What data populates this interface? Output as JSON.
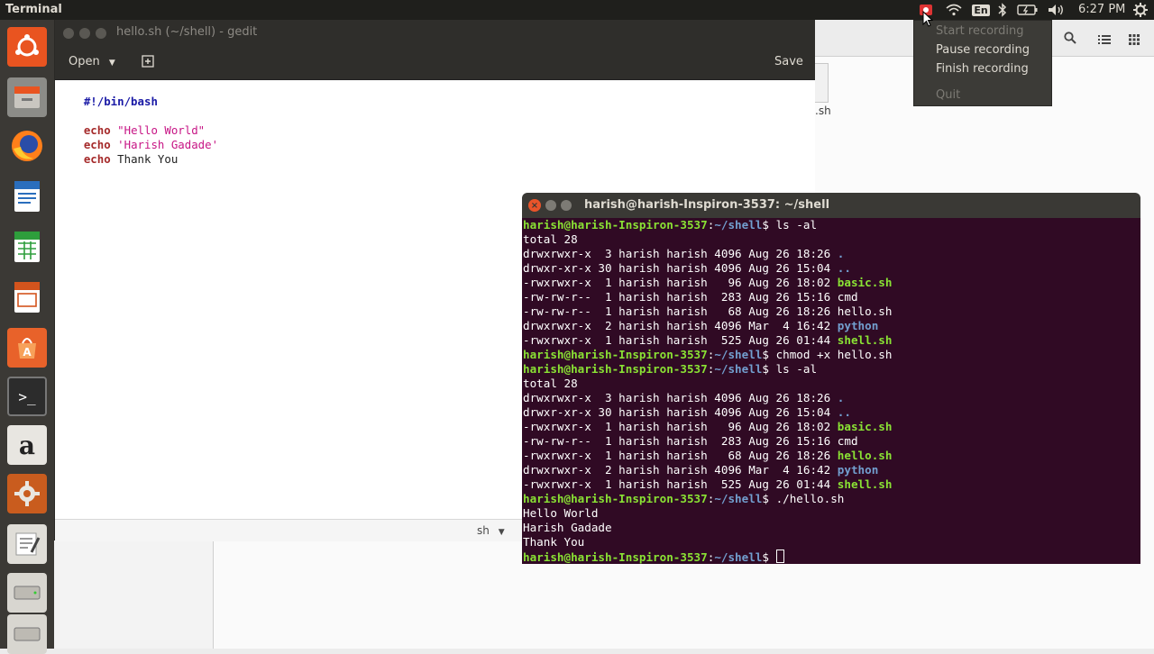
{
  "topbar": {
    "app_name": "Terminal",
    "clock": "6:27 PM",
    "keyboard_layout": "En",
    "icons": [
      "recording-indicator-icon",
      "wifi-icon",
      "keyboard-layout-icon",
      "bluetooth-icon",
      "battery-icon",
      "volume-icon",
      "power-gear-icon"
    ]
  },
  "indicator_menu": {
    "start": "Start recording",
    "pause": "Pause recording",
    "finish": "Finish recording",
    "quit": "Quit"
  },
  "launcher": {
    "items": [
      "ubuntu-dash-icon",
      "files-icon",
      "firefox-icon",
      "libreoffice-writer-icon",
      "libreoffice-calc-icon",
      "libreoffice-impress-icon",
      "software-center-icon",
      "terminal-icon",
      "amazon-icon",
      "system-settings-icon",
      "text-editor-icon",
      "drive-icon",
      "drive-icon-2"
    ]
  },
  "file_manager": {
    "partial_file_label": ".sh"
  },
  "gedit": {
    "title": "hello.sh (~/shell) - gedit",
    "open_label": "Open",
    "save_label": "Save",
    "language": "sh",
    "lines": [
      {
        "kw": "#!/bin/bash",
        "rest": ""
      },
      {
        "kw": "",
        "rest": ""
      },
      {
        "kw": "echo",
        "rest": "\"Hello World\""
      },
      {
        "kw": "echo",
        "rest": "'Harish Gadade'"
      },
      {
        "kw": "echo",
        "rest": "Thank You"
      }
    ]
  },
  "terminal": {
    "title": "harish@harish-Inspiron-3537: ~/shell",
    "prompt_user": "harish@harish-Inspiron-3537",
    "prompt_path": "~/shell",
    "lines": [
      {
        "type": "cmd",
        "cmd": "ls -al"
      },
      {
        "type": "out",
        "text": "total 28"
      },
      {
        "type": "ls",
        "meta": "drwxrwxr-x  3 harish harish 4096 Aug 26 18:26",
        "name": ".",
        "cls": "dir"
      },
      {
        "type": "ls",
        "meta": "drwxr-xr-x 30 harish harish 4096 Aug 26 15:04",
        "name": "..",
        "cls": "dir"
      },
      {
        "type": "ls",
        "meta": "-rwxrwxr-x  1 harish harish   96 Aug 26 18:02",
        "name": "basic.sh",
        "cls": "exe"
      },
      {
        "type": "ls",
        "meta": "-rw-rw-r--  1 harish harish  283 Aug 26 15:16",
        "name": "cmd",
        "cls": ""
      },
      {
        "type": "ls",
        "meta": "-rw-rw-r--  1 harish harish   68 Aug 26 18:26",
        "name": "hello.sh",
        "cls": ""
      },
      {
        "type": "ls",
        "meta": "drwxrwxr-x  2 harish harish 4096 Mar  4 16:42",
        "name": "python",
        "cls": "dir"
      },
      {
        "type": "ls",
        "meta": "-rwxrwxr-x  1 harish harish  525 Aug 26 01:44",
        "name": "shell.sh",
        "cls": "exe"
      },
      {
        "type": "cmd",
        "cmd": "chmod +x hello.sh"
      },
      {
        "type": "cmd",
        "cmd": "ls -al"
      },
      {
        "type": "out",
        "text": "total 28"
      },
      {
        "type": "ls",
        "meta": "drwxrwxr-x  3 harish harish 4096 Aug 26 18:26",
        "name": ".",
        "cls": "dir"
      },
      {
        "type": "ls",
        "meta": "drwxr-xr-x 30 harish harish 4096 Aug 26 15:04",
        "name": "..",
        "cls": "dir"
      },
      {
        "type": "ls",
        "meta": "-rwxrwxr-x  1 harish harish   96 Aug 26 18:02",
        "name": "basic.sh",
        "cls": "exe"
      },
      {
        "type": "ls",
        "meta": "-rw-rw-r--  1 harish harish  283 Aug 26 15:16",
        "name": "cmd",
        "cls": ""
      },
      {
        "type": "ls",
        "meta": "-rwxrwxr-x  1 harish harish   68 Aug 26 18:26",
        "name": "hello.sh",
        "cls": "exe"
      },
      {
        "type": "ls",
        "meta": "drwxrwxr-x  2 harish harish 4096 Mar  4 16:42",
        "name": "python",
        "cls": "dir"
      },
      {
        "type": "ls",
        "meta": "-rwxrwxr-x  1 harish harish  525 Aug 26 01:44",
        "name": "shell.sh",
        "cls": "exe"
      },
      {
        "type": "cmd",
        "cmd": "./hello.sh"
      },
      {
        "type": "out",
        "text": "Hello World"
      },
      {
        "type": "out",
        "text": "Harish Gadade"
      },
      {
        "type": "out",
        "text": "Thank You"
      },
      {
        "type": "prompt",
        "cmd": ""
      }
    ]
  },
  "colors": {
    "terminal_bg": "#300a24",
    "prompt_green": "#8ae234",
    "path_blue": "#729fcf",
    "keyword": "#a52a2a",
    "string": "#c71585",
    "shebang": "#1a1aa6"
  }
}
